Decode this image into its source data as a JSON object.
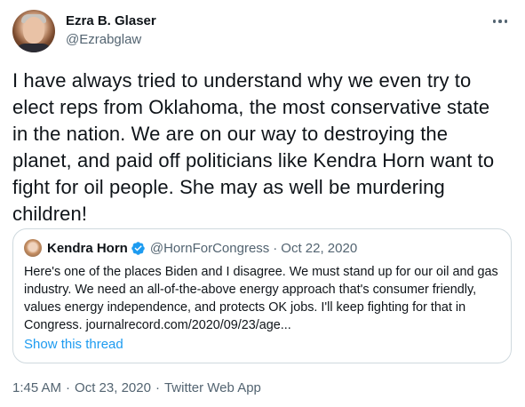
{
  "author": {
    "name": "Ezra B. Glaser",
    "handle": "@Ezrabglaw"
  },
  "tweet": {
    "text": "I have always tried to understand why we even try to elect reps from Oklahoma, the most conservative state in the nation. We are on our way to destroying the planet, and paid off politicians like Kendra Horn want to fight for oil people. She may as well be murdering children!"
  },
  "quoted_tweet": {
    "name": "Kendra Horn",
    "handle": "@HornForCongress",
    "separator": "·",
    "date": "Oct 22, 2020",
    "text": "Here's one of the places Biden and I disagree. We must stand up for our oil and gas industry. We need an all-of-the-above energy approach that's consumer friendly, values energy independence, and protects OK jobs. I'll keep fighting for that in Congress. journalrecord.com/2020/09/23/age...",
    "show_thread": "Show this thread"
  },
  "meta": {
    "time": "1:45 AM",
    "separator": "·",
    "date": "Oct 23, 2020",
    "source": "Twitter Web App"
  },
  "colors": {
    "text": "#0f1419",
    "secondary": "#536471",
    "link": "#1d9bf0",
    "border": "#cfd9de"
  },
  "icons": {
    "more": "more-dots-icon",
    "verified": "verified-badge-icon"
  }
}
